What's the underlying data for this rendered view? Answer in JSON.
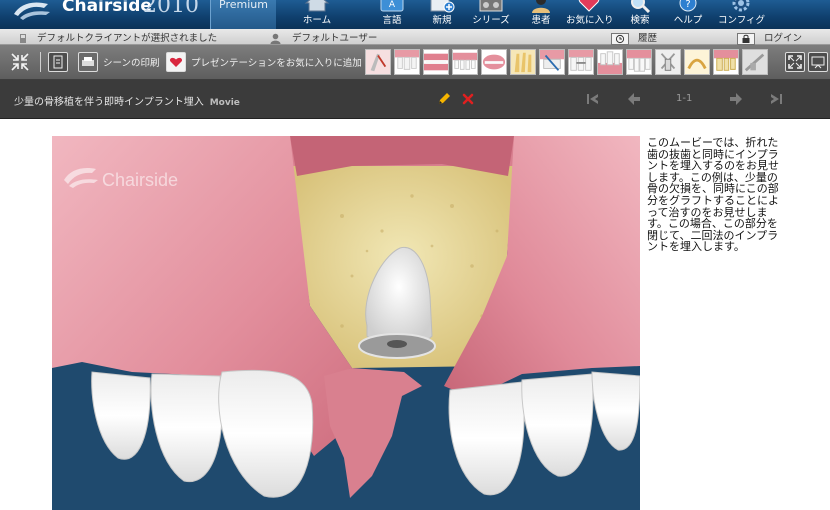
{
  "app": {
    "brand": "Chairside",
    "year": "2010",
    "edition": "Premium",
    "colors": {
      "header": "#1e5c93",
      "accent_red": "#e02020",
      "gum": "#e59aa6",
      "bone": "#e8d9a2",
      "backdrop": "#1f4a6e"
    }
  },
  "nav": [
    {
      "label": "ホーム",
      "icon": "home-icon"
    },
    {
      "label": "言語",
      "icon": "language-icon"
    },
    {
      "label": "新規",
      "icon": "new-icon"
    },
    {
      "label": "シリーズ",
      "icon": "series-icon"
    },
    {
      "label": "患者",
      "icon": "patient-icon"
    },
    {
      "label": "お気に入り",
      "icon": "favorites-icon"
    },
    {
      "label": "検索",
      "icon": "search-icon"
    },
    {
      "label": "ヘルプ",
      "icon": "help-icon"
    },
    {
      "label": "コンフィグ",
      "icon": "config-icon"
    }
  ],
  "statusbar": {
    "client": "デフォルトクライアントが選択されました",
    "user": "デフォルトユーザー",
    "history": "履歴",
    "login": "ログイン"
  },
  "toolbar": {
    "print": "シーンの印刷",
    "add_favorite": "プレゼンテーションをお気に入りに追加"
  },
  "scene": {
    "title": "少量の骨移植を伴う即時インプラント埋入",
    "kind": "Movie",
    "page": "1-1",
    "watermark": "Chairside",
    "description": "このムービーでは、折れた歯の抜歯と同時にインプラントを埋入するのをお見せします。この例は、少量の骨の欠損を、同時にこの部分をグラフトすることによって治すのをお見せします。この場合、この部分を閉じて、二回法のインプラントを埋入します。"
  }
}
